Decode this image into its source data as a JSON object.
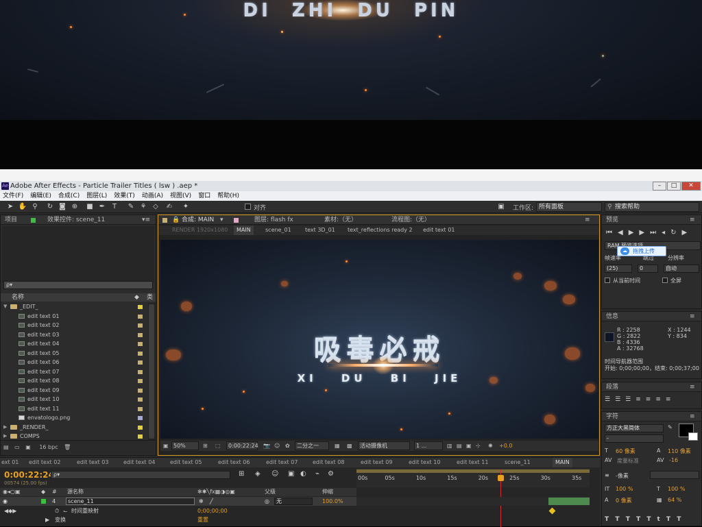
{
  "banner": {
    "title": "DI ZHI DU PIN"
  },
  "window": {
    "title": "Adobe After Effects - Particle Trailer Titles ( lsw ) .aep *",
    "app_icon": "Ae"
  },
  "menu": [
    "文件(F)",
    "编辑(E)",
    "合成(C)",
    "图层(L)",
    "效果(T)",
    "动画(A)",
    "视图(V)",
    "窗口",
    "帮助(H)"
  ],
  "toolbar": {
    "snap_label": "对齐",
    "workspace_label": "工作区:",
    "workspace_value": "所有面板",
    "search_placeholder": "搜索帮助"
  },
  "project": {
    "tab_project": "项目",
    "tab_effects": "效果控件: scene_11",
    "search_value": "ρ▾",
    "col_name": "名称",
    "col_type": "类",
    "items": [
      {
        "name": "_EDIT_",
        "kind": "folder",
        "expanded": true,
        "indent": 0,
        "label_color": "#e0d040"
      },
      {
        "name": "edit text 01",
        "kind": "comp",
        "indent": 1,
        "label_color": "#c8b070"
      },
      {
        "name": "edit text 02",
        "kind": "comp",
        "indent": 1,
        "label_color": "#c8b070"
      },
      {
        "name": "edit text 03",
        "kind": "comp",
        "indent": 1,
        "label_color": "#c8b070"
      },
      {
        "name": "edit text 04",
        "kind": "comp",
        "indent": 1,
        "label_color": "#c8b070"
      },
      {
        "name": "edit text 05",
        "kind": "comp",
        "indent": 1,
        "label_color": "#c8b070"
      },
      {
        "name": "edit text 06",
        "kind": "comp",
        "indent": 1,
        "label_color": "#c8b070"
      },
      {
        "name": "edit text 07",
        "kind": "comp",
        "indent": 1,
        "label_color": "#c8b070"
      },
      {
        "name": "edit text 08",
        "kind": "comp",
        "indent": 1,
        "label_color": "#c8b070"
      },
      {
        "name": "edit text 09",
        "kind": "comp",
        "indent": 1,
        "label_color": "#c8b070"
      },
      {
        "name": "edit text 10",
        "kind": "comp",
        "indent": 1,
        "label_color": "#c8b070"
      },
      {
        "name": "edit text 11",
        "kind": "comp",
        "indent": 1,
        "label_color": "#c8b070"
      },
      {
        "name": "envatologo.png",
        "kind": "file",
        "indent": 1,
        "label_color": "#a8a8d8"
      },
      {
        "name": "_RENDER_",
        "kind": "folder",
        "expanded": false,
        "indent": 0,
        "label_color": "#e0d040"
      },
      {
        "name": "COMPS",
        "kind": "folder",
        "expanded": false,
        "indent": 0,
        "label_color": "#e0d040"
      },
      {
        "name": "AUDIO",
        "kind": "folder",
        "expanded": false,
        "indent": 0,
        "label_color": "#e0d040"
      }
    ],
    "bpc": "16 bpc"
  },
  "composition": {
    "tab_comp": "合成: MAIN",
    "tab_layer": "图层: flash fx",
    "tab_footage": "素材:（无）",
    "tab_flow": "流程图:（无）",
    "render_label": "RENDER 1920x1080",
    "crumbs": [
      "MAIN",
      "scene_01",
      "text 3D_01",
      "text_reflections ready 2",
      "edit text 01"
    ],
    "title_cn": "吸毒必戒",
    "subtitle": "XI DU BI JIE",
    "zoom": "50%",
    "timecode": "0:00:22:24",
    "resolution": "二分之一",
    "camera": "活动摄像机",
    "views": "1 ...",
    "exposure": "+0.0"
  },
  "preview": {
    "tab": "预览",
    "ram_options": "RAM 预览选项",
    "frame_rate_label": "帧速率",
    "skip_label": "跳过",
    "resolution_label": "分辨率",
    "fps_value": "(25)",
    "skip_value": "0",
    "res_value": "自动",
    "from_current": "从当前时间",
    "fullscreen": "全屏",
    "tooltip": "拖拽上传"
  },
  "info": {
    "tab": "信息",
    "r": "R : 2258",
    "g": "G : 2822",
    "b": "B : 4336",
    "a": "A : 32768",
    "x": "X : 1244",
    "y": "Y : 834",
    "nav_title": "时间导航器范围",
    "nav_range": "开始: 0;00;00;00，结束: 0;00;37;00"
  },
  "paragraph": {
    "tab": "段落"
  },
  "character": {
    "tab": "字符",
    "font": "方正大黑简体",
    "style": "-",
    "size": "60 像素",
    "leading": "110 像素",
    "kerning": "度量标准",
    "tracking": "-16",
    "stroke_width": "-像素",
    "vscale": "100 %",
    "hscale": "100 %",
    "baseline": "0 像素",
    "tsume": "64 %"
  },
  "timeline": {
    "tabs": [
      "ext 01",
      "edit text 02",
      "edit text 03",
      "edit text 04",
      "edit text 05",
      "edit text 06",
      "edit text 07",
      "edit text 08",
      "edit text 09",
      "edit text 10",
      "edit text 11",
      "scene_11",
      "MAIN"
    ],
    "timecode": "0:00:22:24",
    "timecode_sub": "00574 (25.00 fps)",
    "search_value": "ρ▾",
    "ruler": [
      "00s",
      "05s",
      "10s",
      "15s",
      "20s",
      "25s",
      "30s",
      "35s"
    ],
    "col_source": "源名称",
    "col_parent": "父级",
    "col_stretch": "伸缩",
    "layer_num": "4",
    "layer_name": "scene_11",
    "layer_parent": "无",
    "layer_stretch": "100.0%",
    "remap_label": "时间重映射",
    "remap_value": "0;00;00;00",
    "transform_label": "变换",
    "transform_reset": "重置"
  }
}
